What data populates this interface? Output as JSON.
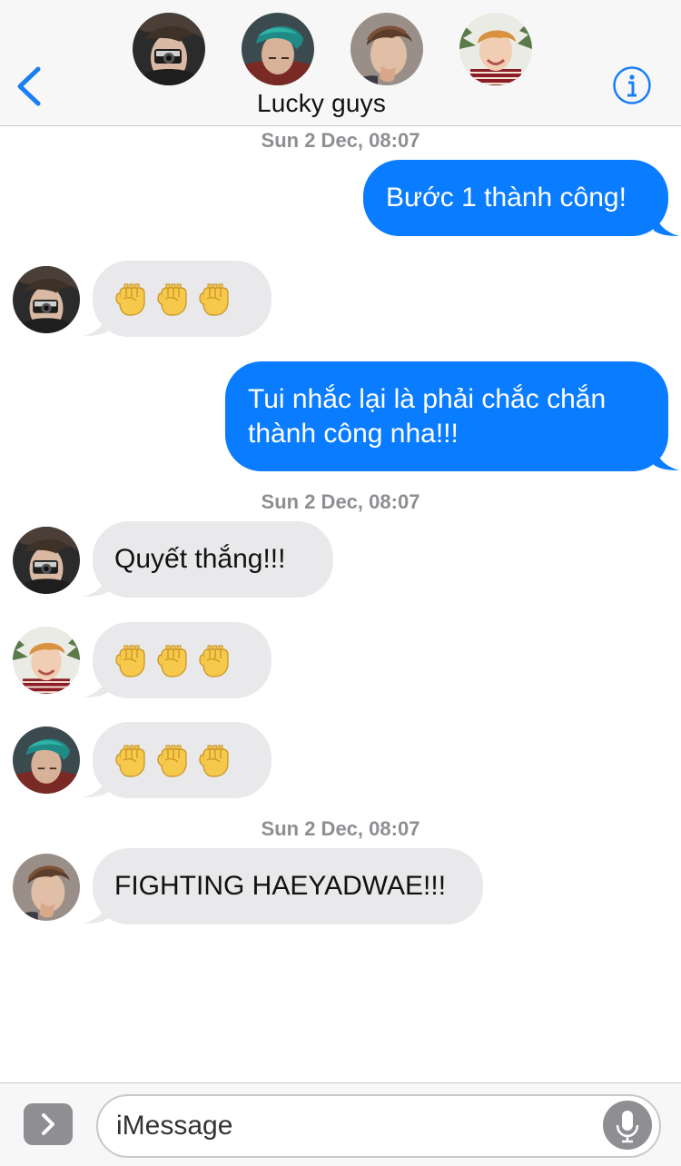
{
  "header": {
    "title": "Lucky guys",
    "back_icon": "chevron-left-icon",
    "info_icon": "info-icon",
    "accent": "#1a7ff5"
  },
  "timestamps": [
    {
      "day": "Sun 2 Dec,",
      "time": "08:07"
    },
    {
      "day": "Sun 2 Dec,",
      "time": "08:07"
    },
    {
      "day": "Sun 2 Dec,",
      "time": "08:07"
    }
  ],
  "messages": [
    {
      "from": "me",
      "text": "Bước 1 thành công!"
    },
    {
      "from": "member-1",
      "text": "✊✊✊"
    },
    {
      "from": "me",
      "lines": [
        "Tui nhắc lại là phải chắc chắn",
        "thành công nha!!!"
      ]
    },
    {
      "from": "member-1",
      "text": "Quyết thắng!!!"
    },
    {
      "from": "member-4",
      "text": "✊✊✊"
    },
    {
      "from": "member-2",
      "text": "✊✊✊"
    },
    {
      "from": "member-3",
      "text": "FIGHTING HAEYADWAE!!!"
    }
  ],
  "colors": {
    "outgoing_bubble": "#0a7cff",
    "incoming_bubble": "#e9e9eb",
    "timestamp": "#8e8e93"
  },
  "composer": {
    "placeholder": "iMessage",
    "expand_icon": "chevron-right-icon",
    "mic_icon": "microphone-icon"
  }
}
